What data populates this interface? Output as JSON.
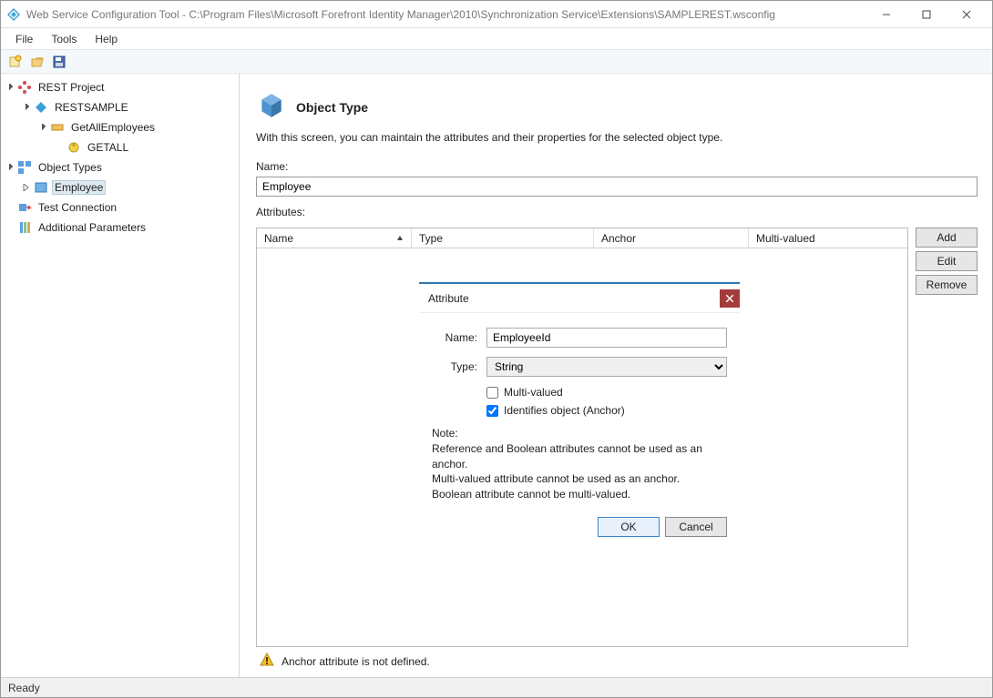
{
  "window": {
    "title": "Web Service Configuration Tool - C:\\Program Files\\Microsoft Forefront Identity Manager\\2010\\Synchronization Service\\Extensions\\SAMPLEREST.wsconfig"
  },
  "menu": {
    "file": "File",
    "tools": "Tools",
    "help": "Help"
  },
  "tree": {
    "rest_project": "REST Project",
    "restsample": "RESTSAMPLE",
    "get_all_employees": "GetAllEmployees",
    "getall": "GETALL",
    "object_types": "Object Types",
    "employee": "Employee",
    "test_connection": "Test Connection",
    "additional_params": "Additional Parameters"
  },
  "panel": {
    "title": "Object Type",
    "description": "With this screen, you can maintain the attributes and their properties for the selected object type.",
    "name_label": "Name:",
    "name_value": "Employee",
    "attributes_label": "Attributes:",
    "columns": {
      "name": "Name",
      "type": "Type",
      "anchor": "Anchor",
      "multi": "Multi-valued"
    },
    "buttons": {
      "add": "Add",
      "edit": "Edit",
      "remove": "Remove"
    }
  },
  "modal": {
    "title": "Attribute",
    "name_label": "Name:",
    "name_value": "EmployeeId",
    "type_label": "Type:",
    "type_value": "String",
    "multivalued_label": "Multi-valued",
    "multivalued_checked": false,
    "anchor_label": "Identifies object (Anchor)",
    "anchor_checked": true,
    "note_title": "Note:",
    "note_line1": "Reference and Boolean attributes cannot be used as an anchor.",
    "note_line2": "Multi-valued attribute cannot be used as an anchor.",
    "note_line3": "Boolean attribute cannot be multi-valued.",
    "ok": "OK",
    "cancel": "Cancel"
  },
  "warning": "Anchor attribute is not defined.",
  "status": "Ready"
}
